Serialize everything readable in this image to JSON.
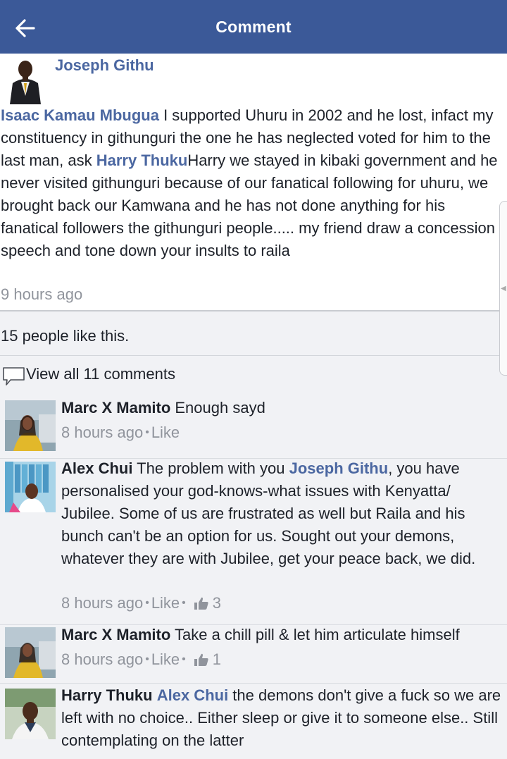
{
  "header": {
    "title": "Comment",
    "back_icon": "back-arrow-icon"
  },
  "colors": {
    "header_bg": "#3b5998",
    "link": "#4b67a1",
    "muted": "#90949c",
    "panel": "#f1f2f5"
  },
  "post": {
    "author": "Joseph Githu",
    "mention1": "Isaac Kamau Mbugua",
    "text1": " I supported Uhuru in 2002 and he lost, infact my constituency in githunguri the one he has neglected voted for him to the last man, ask ",
    "mention2": "Harry Thuku",
    "text2": "Harry we stayed in kibaki government and he never visited githunguri because of our fanatical following for uhuru, we brought back our Kamwana and he has not done anything for his fanatical followers the githunguri people..... my friend draw a concession  speech and tone down your insults to raila",
    "time": "9 hours ago"
  },
  "likes_text": "15 people like this.",
  "view_all": "View all 11 comments",
  "comments": [
    {
      "author": "Marc X Mamito",
      "text": " Enough sayd",
      "time": "8 hours ago",
      "like_label": "Like"
    },
    {
      "author": "Alex Chui",
      "text_pre": " The problem with you ",
      "mention": "Joseph Githu",
      "text_post": ", you have personalised your god-knows-what issues with Kenyatta/ Jubilee. Some of us are frustrated as well but Raila and his bunch can't be an option for us. Sought out your demons, whatever they are with Jubilee, get your peace back, we did.",
      "time": "8 hours ago",
      "like_label": "Like",
      "like_count": "3"
    },
    {
      "author": "Marc X Mamito",
      "text": " Take a chill pill & let him articulate himself",
      "time": "8 hours ago",
      "like_label": "Like",
      "like_count": "1"
    },
    {
      "author": "Harry Thuku",
      "mention": "Alex Chui",
      "text": " the demons don't give a fuck so we are left with no choice..  Either sleep or give it to someone else..  Still contemplating on the latter"
    }
  ]
}
